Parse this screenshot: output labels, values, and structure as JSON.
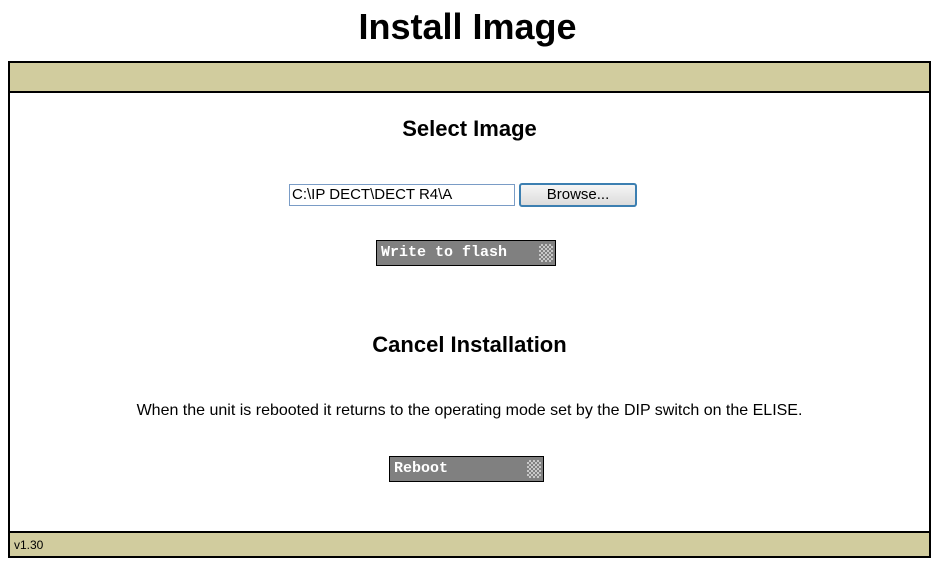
{
  "page": {
    "title": "Install Image"
  },
  "select_section": {
    "heading": "Select Image",
    "file_value": "C:\\IP DECT\\DECT R4\\A",
    "browse_label": "Browse...",
    "write_label": "Write to flash"
  },
  "cancel_section": {
    "heading": "Cancel Installation",
    "description": "When the unit is rebooted it returns to the operating mode set by the DIP switch on the ELISE.",
    "reboot_label": "Reboot"
  },
  "footer": {
    "version": "v1.30"
  },
  "colors": {
    "bar": "#d1cc9e",
    "dark_button": "#808080",
    "browse_border": "#3c7fb1"
  }
}
